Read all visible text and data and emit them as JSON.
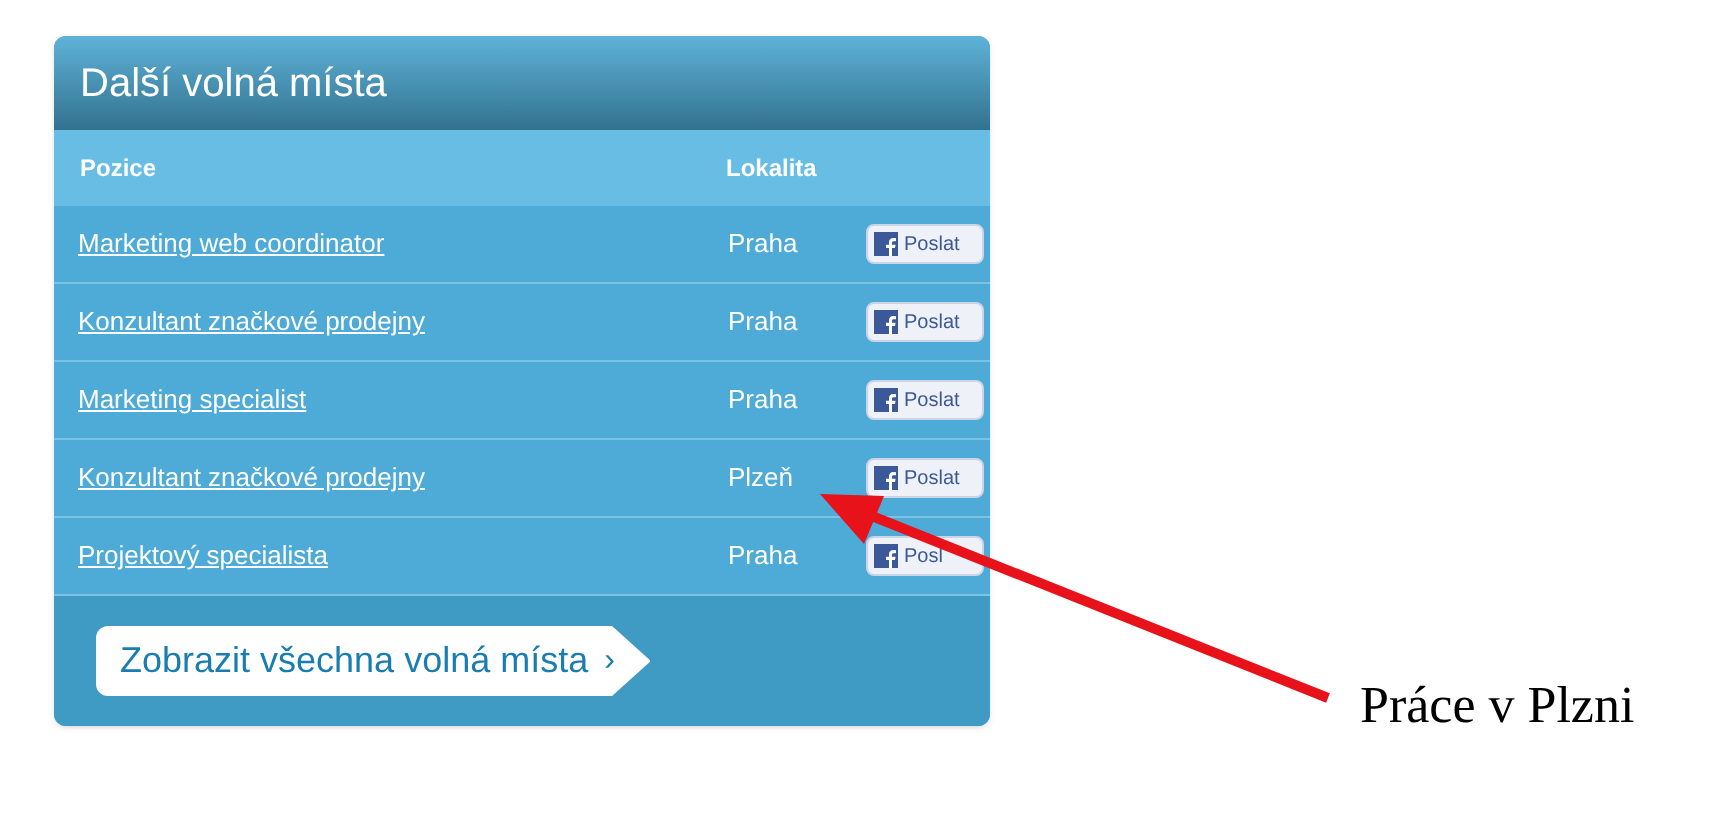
{
  "panel": {
    "title": "Další volná místa",
    "columns": [
      "Pozice",
      "Lokalita"
    ],
    "rows": [
      {
        "position": "Marketing web coordinator",
        "location": "Praha",
        "share": "Poslat"
      },
      {
        "position": "Konzultant značkové prodejny",
        "location": "Praha",
        "share": "Poslat"
      },
      {
        "position": "Marketing specialist",
        "location": "Praha",
        "share": "Poslat"
      },
      {
        "position": "Konzultant značkové prodejny",
        "location": "Plzeň",
        "share": "Poslat"
      },
      {
        "position": "Projektový specialista",
        "location": "Praha",
        "share": "Posl"
      }
    ],
    "more_button": "Zobrazit všechna volná místa",
    "more_chevron": "›"
  },
  "annotation": {
    "text": "Práce v Plzni"
  }
}
